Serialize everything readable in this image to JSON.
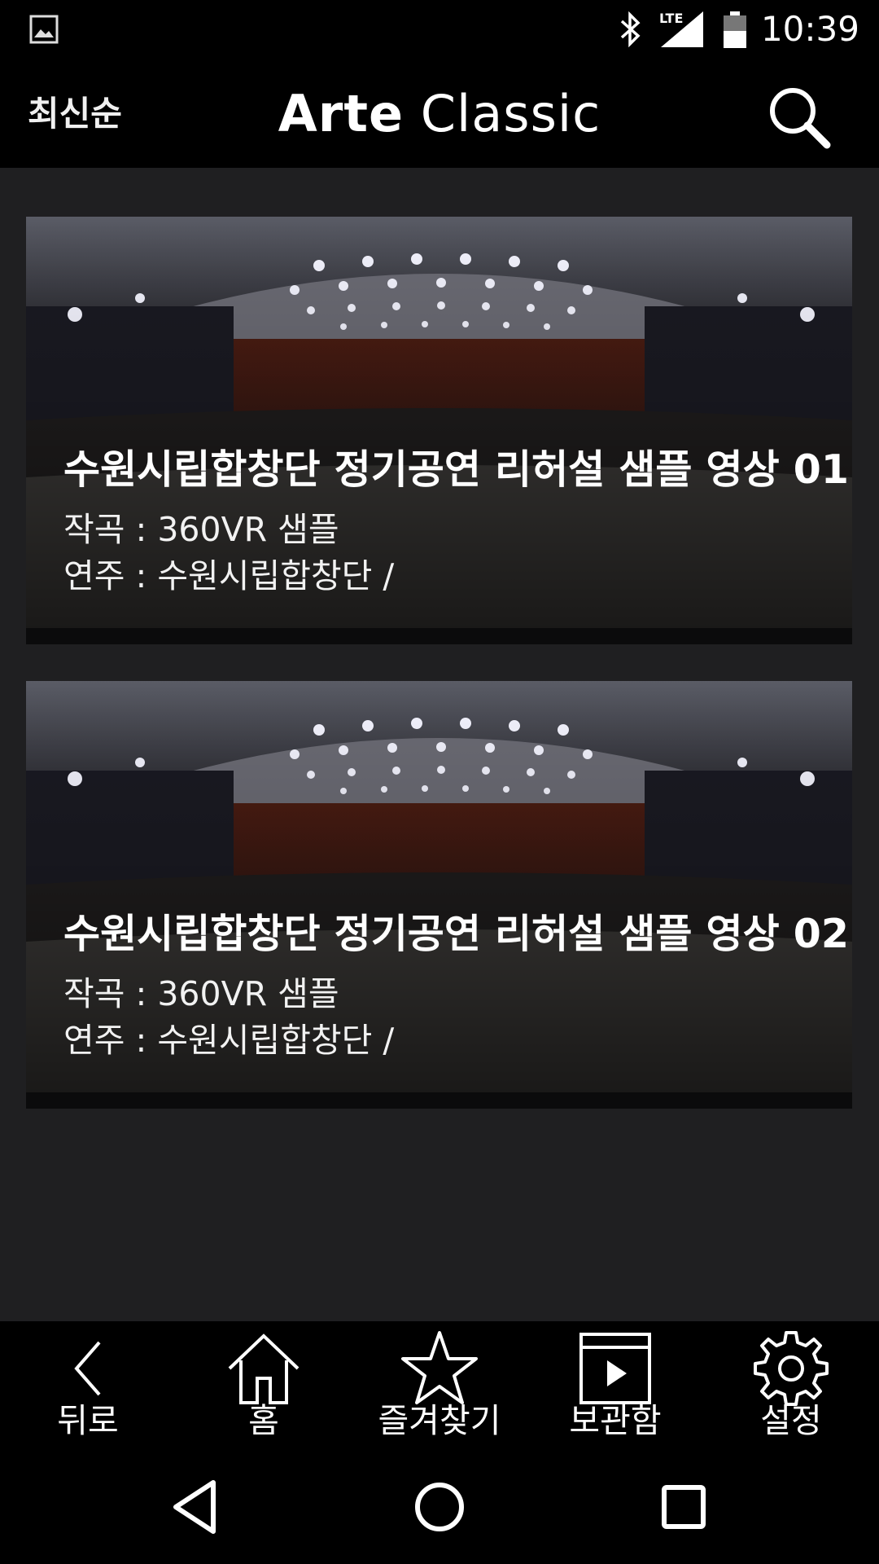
{
  "status_bar": {
    "time": "10:39",
    "icons": [
      "gallery-icon",
      "bluetooth-icon",
      "lte-signal-icon",
      "battery-icon"
    ],
    "lte_label": "LTE"
  },
  "app_bar": {
    "sort_label": "최신순",
    "title_bold": "Arte",
    "title_light": " Classic",
    "search_icon": "search-icon"
  },
  "videos": [
    {
      "title": "수원시립합창단 정기공연 리허설 샘플 영상 01",
      "composer": "작곡 : 360VR 샘플",
      "performer": "연주 : 수원시립합창단 /"
    },
    {
      "title": "수원시립합창단 정기공연 리허설 샘플 영상 02",
      "composer": "작곡 : 360VR 샘플",
      "performer": "연주 : 수원시립합창단 /"
    }
  ],
  "bottom_nav": [
    {
      "label": "뒤로",
      "icon": "back-chevron-icon"
    },
    {
      "label": "홈",
      "icon": "home-icon"
    },
    {
      "label": "즐겨찾기",
      "icon": "star-icon"
    },
    {
      "label": "보관함",
      "icon": "video-archive-icon"
    },
    {
      "label": "설정",
      "icon": "gear-icon"
    }
  ],
  "system_nav": [
    "back-triangle-icon",
    "home-circle-icon",
    "recents-square-icon"
  ],
  "colors": {
    "background": "#1f1f21",
    "bar": "#000000",
    "text": "#ffffff"
  }
}
